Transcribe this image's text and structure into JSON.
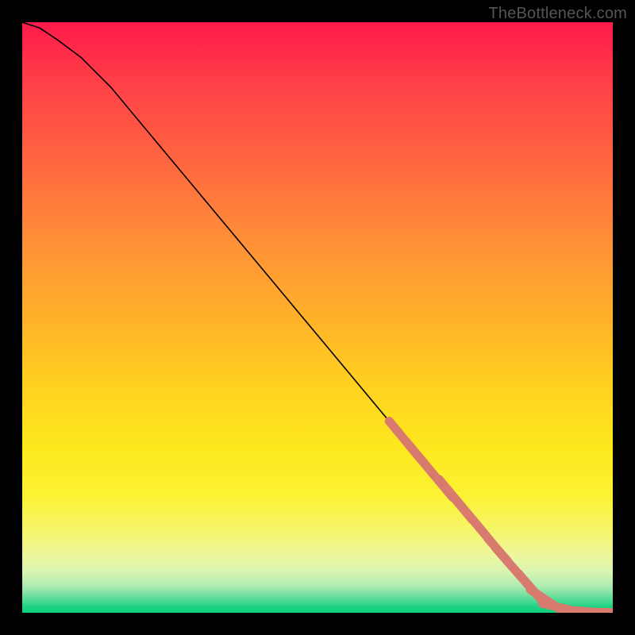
{
  "watermark": "TheBottleneck.com",
  "colors": {
    "marker": "#d97a6f",
    "curve": "#000000"
  },
  "chart_data": {
    "type": "line",
    "title": "",
    "xlabel": "",
    "ylabel": "",
    "xlim": [
      0,
      100
    ],
    "ylim": [
      0,
      100
    ],
    "grid": false,
    "legend": false,
    "series": [
      {
        "name": "curve",
        "kind": "line",
        "x": [
          0,
          3,
          6,
          10,
          15,
          20,
          30,
          40,
          50,
          60,
          70,
          80,
          87,
          90,
          93,
          96,
          100
        ],
        "y": [
          100,
          99,
          97,
          94,
          89,
          83,
          71,
          59,
          47,
          35,
          23,
          11,
          3,
          1,
          0.3,
          0.1,
          0.05
        ]
      },
      {
        "name": "markers",
        "kind": "scatter",
        "points": [
          {
            "x": 65.0,
            "y": 29.0,
            "l": 4.5
          },
          {
            "x": 66.5,
            "y": 27.2,
            "l": 2.5
          },
          {
            "x": 68.0,
            "y": 25.4,
            "l": 4.0
          },
          {
            "x": 70.0,
            "y": 23.0,
            "l": 4.5
          },
          {
            "x": 72.5,
            "y": 20.3,
            "l": 3.0
          },
          {
            "x": 74.0,
            "y": 18.4,
            "l": 3.5
          },
          {
            "x": 76.0,
            "y": 16.1,
            "l": 3.5
          },
          {
            "x": 77.5,
            "y": 14.3,
            "l": 2.5
          },
          {
            "x": 79.0,
            "y": 12.5,
            "l": 3.5
          },
          {
            "x": 80.5,
            "y": 10.7,
            "l": 2.5
          },
          {
            "x": 82.0,
            "y": 8.9,
            "l": 3.0
          },
          {
            "x": 84.0,
            "y": 6.6,
            "l": 3.0
          },
          {
            "x": 86.0,
            "y": 4.4,
            "l": 3.0
          },
          {
            "x": 88.5,
            "y": 2.3,
            "l": 3.0
          },
          {
            "x": 91.0,
            "y": 0.9,
            "l": 3.0
          },
          {
            "x": 93.5,
            "y": 0.35,
            "l": 2.0
          },
          {
            "x": 96.0,
            "y": 0.15,
            "l": 2.5
          },
          {
            "x": 99.0,
            "y": 0.07,
            "l": 2.0
          }
        ]
      }
    ]
  }
}
